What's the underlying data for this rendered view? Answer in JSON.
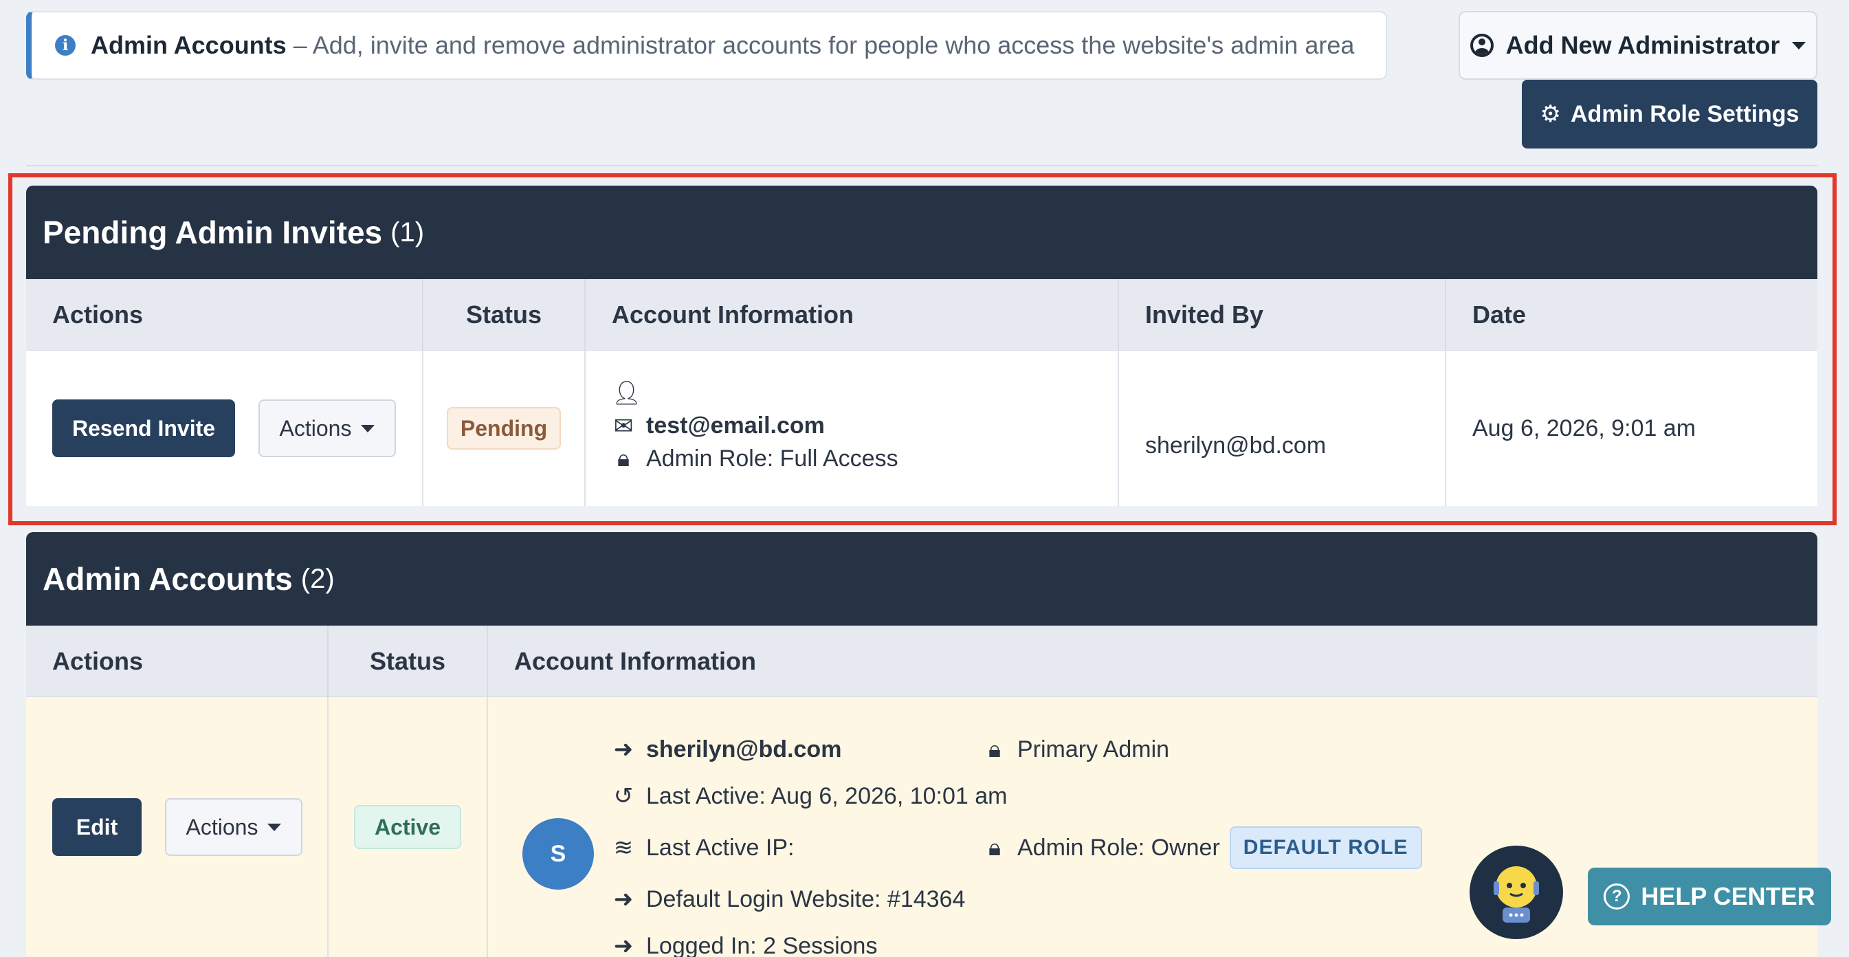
{
  "banner": {
    "title": "Admin Accounts",
    "description": "– Add, invite and remove administrator accounts for people who access the website's admin area"
  },
  "toolbar": {
    "add_admin_label": "Add New Administrator",
    "role_settings_label": "Admin Role Settings"
  },
  "pending": {
    "title": "Pending Admin Invites",
    "count": "(1)",
    "headers": [
      "Actions",
      "Status",
      "Account Information",
      "Invited By",
      "Date"
    ],
    "row": {
      "resend_label": "Resend Invite",
      "actions_label": "Actions",
      "status": "Pending",
      "email": "test@email.com",
      "role": "Admin Role: Full Access",
      "invited_by": "sherilyn@bd.com",
      "date": "Aug 6, 2026, 9:01 am"
    }
  },
  "accounts": {
    "title": "Admin Accounts",
    "count": "(2)",
    "headers": [
      "Actions",
      "Status",
      "Account Information"
    ],
    "row": {
      "edit_label": "Edit",
      "actions_label": "Actions",
      "status": "Active",
      "avatar_initial": "S",
      "email": "sherilyn@bd.com",
      "last_active": "Last Active: Aug 6, 2026, 10:01 am",
      "last_ip": "Last Active IP:",
      "default_site": "Default Login Website: #14364",
      "logged_in": "Logged In: 2 Sessions",
      "primary": "Primary Admin",
      "role": "Admin Role: Owner",
      "role_badge": "DEFAULT ROLE"
    }
  },
  "help": {
    "label": "HELP CENTER"
  },
  "colors": {
    "panel_header": "#263344",
    "primary_button": "#27405e",
    "accent": "#3d7fc4",
    "highlight": "#e0392b",
    "active_row_bg": "#fdf7e4",
    "help_button": "#3f8fa6"
  }
}
